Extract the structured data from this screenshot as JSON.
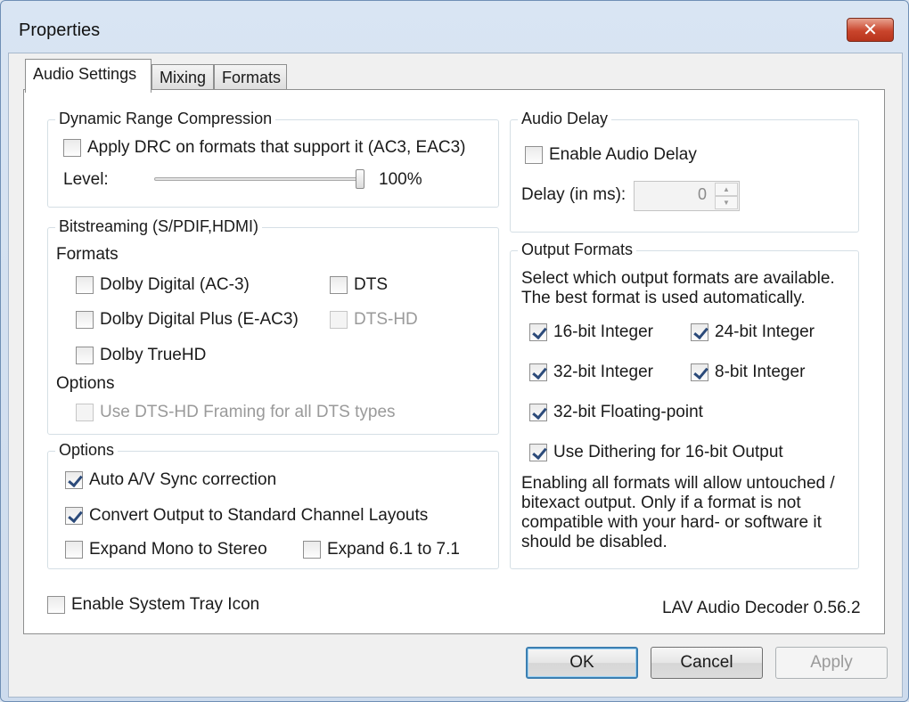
{
  "window": {
    "title": "Properties",
    "close_glyph": "✕"
  },
  "tabs": [
    {
      "label": "Audio Settings",
      "active": true
    },
    {
      "label": "Mixing",
      "active": false
    },
    {
      "label": "Formats",
      "active": false
    }
  ],
  "drc": {
    "legend": "Dynamic Range Compression",
    "apply_label": "Apply DRC on formats that support it (AC3, EAC3)",
    "apply_checked": false,
    "level_label": "Level:",
    "level_value_text": "100%",
    "level_fraction": 1.0
  },
  "bitstreaming": {
    "legend": "Bitstreaming (S/PDIF,HDMI)",
    "formats_label": "Formats",
    "dolby_digital": "Dolby Digital (AC-3)",
    "dts": "DTS",
    "dolby_digital_plus": "Dolby Digital Plus (E-AC3)",
    "dts_hd": "DTS-HD",
    "dolby_truehd": "Dolby TrueHD",
    "options_label": "Options",
    "dts_hd_framing": "Use DTS-HD Framing for all DTS types"
  },
  "options": {
    "legend": "Options",
    "auto_sync": "Auto A/V Sync correction",
    "convert_layouts": "Convert Output to Standard Channel Layouts",
    "expand_mono": "Expand Mono to Stereo",
    "expand_61": "Expand 6.1 to 7.1"
  },
  "audio_delay": {
    "legend": "Audio Delay",
    "enable_label": "Enable Audio Delay",
    "delay_label": "Delay (in ms):",
    "delay_value": "0",
    "up_glyph": "▲",
    "down_glyph": "▼"
  },
  "output_formats": {
    "legend": "Output Formats",
    "description_line1": "Select which output formats are available.",
    "description_line2": "The best format is used automatically.",
    "int16": "16-bit Integer",
    "int24": "24-bit Integer",
    "int32": "32-bit Integer",
    "int8": "8-bit Integer",
    "float32": "32-bit Floating-point",
    "dithering": "Use Dithering for 16-bit Output",
    "note_line1": "Enabling all formats will allow untouched /",
    "note_line2": "bitexact output. Only if a format is not",
    "note_line3": "compatible with your hard- or software it",
    "note_line4": "should be disabled."
  },
  "tray_icon_label": "Enable System Tray Icon",
  "version_text": "LAV Audio Decoder 0.56.2",
  "buttons": {
    "ok": "OK",
    "cancel": "Cancel",
    "apply": "Apply"
  }
}
